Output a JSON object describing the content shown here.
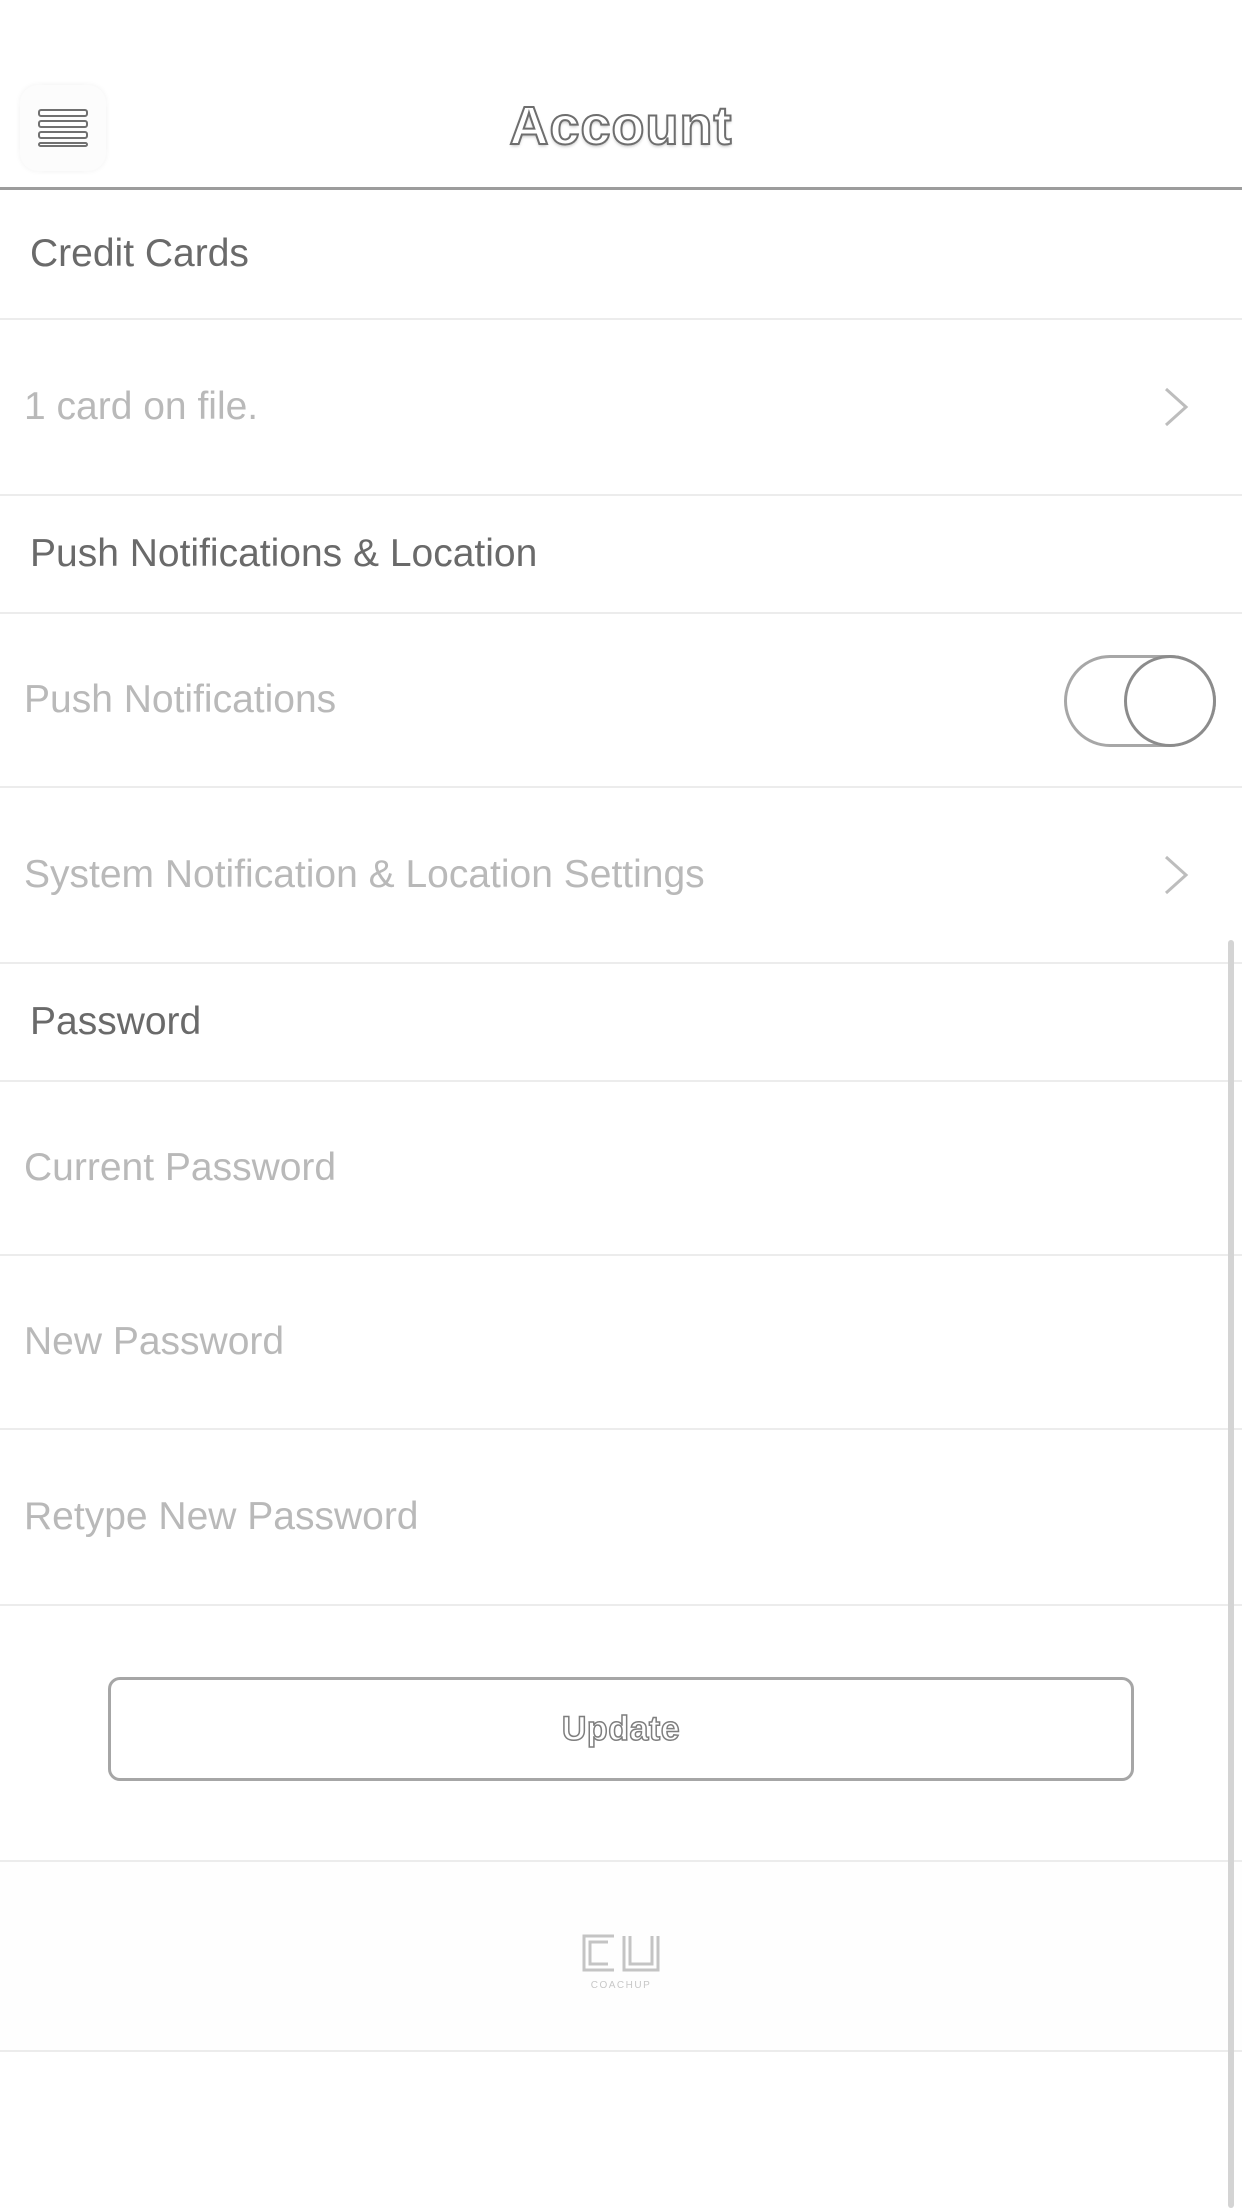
{
  "header": {
    "title": "Account",
    "menu_icon": "hamburger-menu-icon"
  },
  "credit_cards": {
    "section_label": "Credit Cards",
    "cards_on_file": "1 card on file."
  },
  "notifications": {
    "section_label": "Push Notifications & Location",
    "push_label": "Push Notifications",
    "push_enabled": true,
    "system_settings_label": "System Notification & Location Settings"
  },
  "password": {
    "section_label": "Password",
    "current_placeholder": "Current Password",
    "new_placeholder": "New Password",
    "retype_placeholder": "Retype New Password",
    "update_label": "Update"
  },
  "footer": {
    "logo_text": "CU",
    "logo_subtext": "COACHUP"
  },
  "colors": {
    "divider": "#ececec",
    "section_text": "#6a6a6a",
    "item_text": "#b9b9b9",
    "border": "#a6a6a6"
  }
}
